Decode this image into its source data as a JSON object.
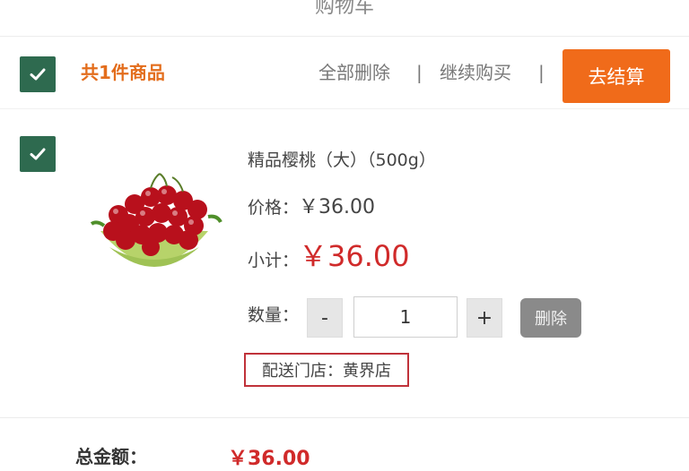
{
  "page": {
    "title": "购物车"
  },
  "summary": {
    "count_text": "共1件商品",
    "delete_all_label": "全部删除",
    "separator": "|",
    "continue_label": "继续购买",
    "checkout_label": "去结算"
  },
  "item": {
    "name": "精品樱桃（大）（500g）",
    "price_label": "价格：",
    "price_value": "￥36.00",
    "subtotal_label": "小计：",
    "subtotal_value": "￥36.00",
    "qty_label": "数量：",
    "minus_label": "-",
    "qty_value": "1",
    "plus_label": "+",
    "delete_label": "删除",
    "store_text": "配送门店：黄界店"
  },
  "totals": {
    "label": "总金额：",
    "value": "￥36.00"
  },
  "colors": {
    "accent": "#f06b1a",
    "checkbox": "#2e6a4f",
    "price_red": "#d02a2a",
    "store_border": "#c0323a"
  },
  "icons": {
    "checkbox": "checkmark-icon",
    "product": "cherry-bowl-image"
  }
}
